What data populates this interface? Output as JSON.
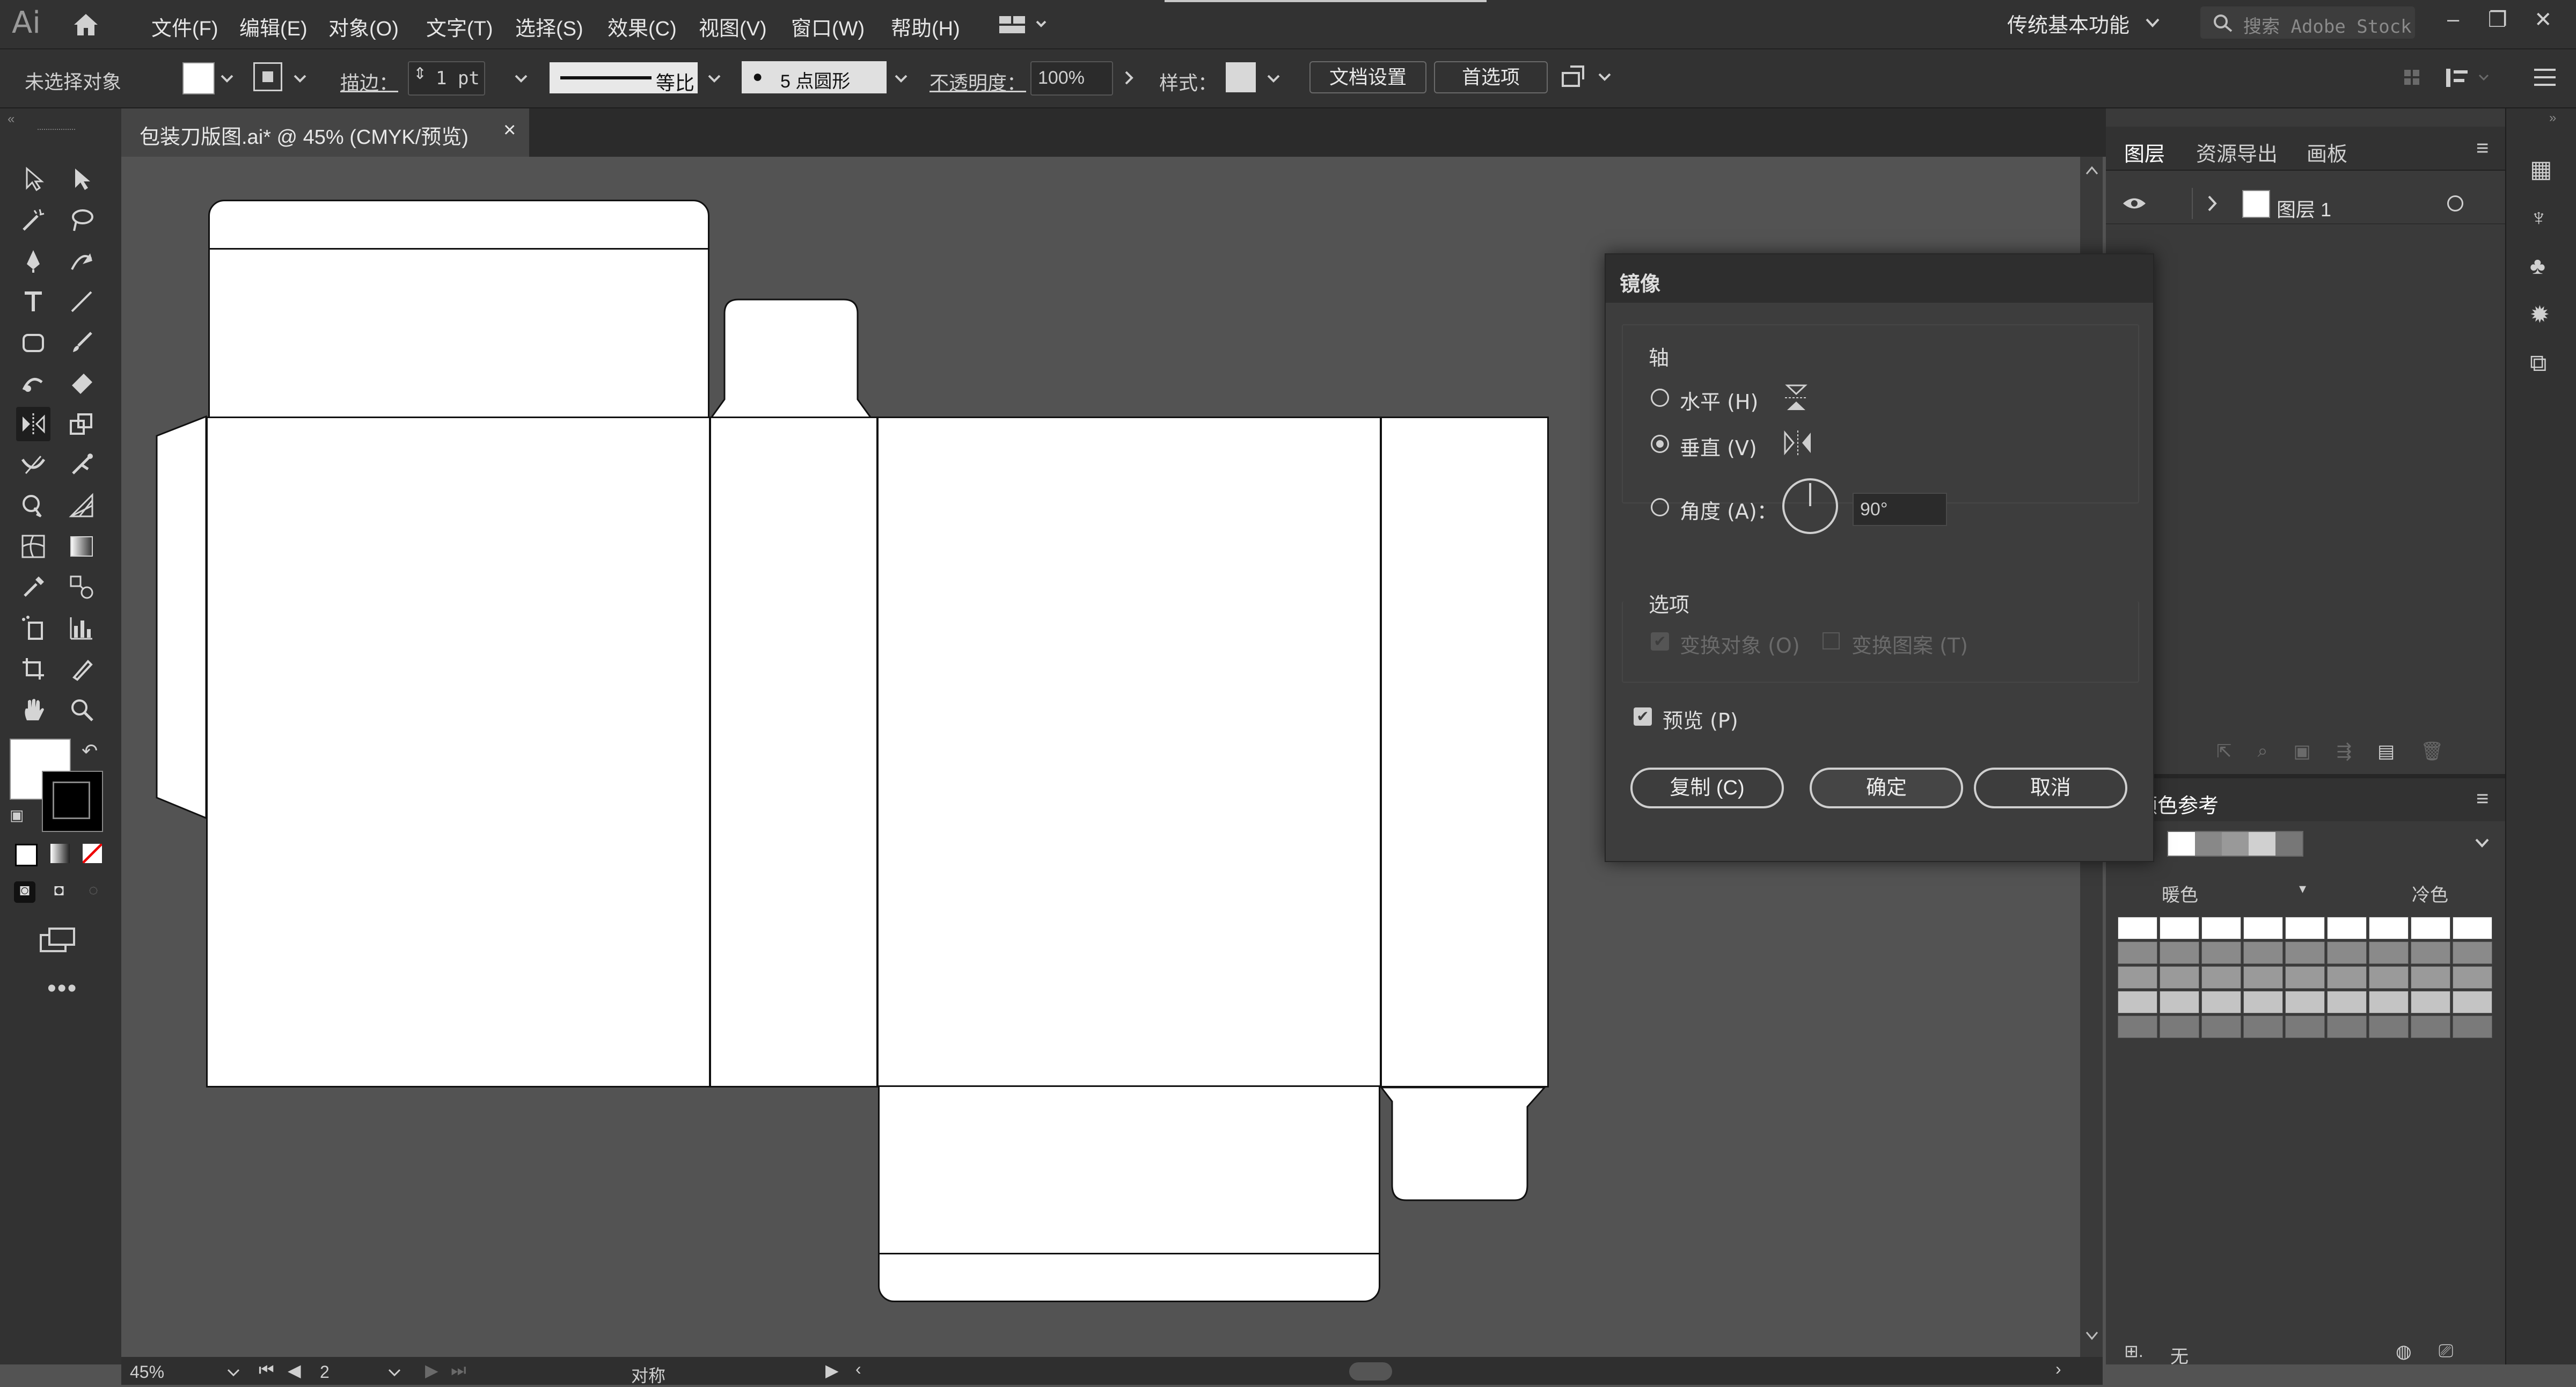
{
  "app": {
    "logo": "Ai"
  },
  "menu": [
    "文件(F)",
    "编辑(E)",
    "对象(O)",
    "文字(T)",
    "选择(S)",
    "效果(C)",
    "视图(V)",
    "窗口(W)",
    "帮助(H)"
  ],
  "workspace": "传统基本功能",
  "search": {
    "placeholder": "搜索 Adobe Stock"
  },
  "control": {
    "selection": "未选择对象",
    "stroke_label": "描边：",
    "stroke_weight": "1 pt",
    "stroke_profile": "等比",
    "brush": "5 点圆形",
    "opacity_label": "不透明度：",
    "opacity": "100%",
    "style_label": "样式：",
    "doc_setup": "文档设置",
    "preferences": "首选项"
  },
  "document_tab": {
    "title": "包装刀版图.ai* @ 45% (CMYK/预览)",
    "close": "×"
  },
  "panels": {
    "layers_tabs": [
      "图层",
      "资源导出",
      "画板"
    ],
    "layer_name": "图层 1",
    "color_guide_title": "颜色参考",
    "warm_label": "暖色",
    "cool_label": "冷色",
    "footer_none": "无"
  },
  "dialog": {
    "title": "镜像",
    "axis_label": "轴",
    "horizontal": "水平 (H)",
    "vertical": "垂直 (V)",
    "angle": "角度 (A)：",
    "angle_value": "90°",
    "selected_axis": "vertical",
    "options_label": "选项",
    "transform_objects": "变换对象 (O)",
    "transform_patterns": "变换图案 (T)",
    "preview": "预览 (P)",
    "copy": "复制 (C)",
    "ok": "确定",
    "cancel": "取消"
  },
  "status": {
    "zoom": "45%",
    "artboard": "2",
    "tool": "对称"
  },
  "colors": {
    "ui_dark": "#323232",
    "canvas": "#535353",
    "artwork": "#ffffff"
  }
}
